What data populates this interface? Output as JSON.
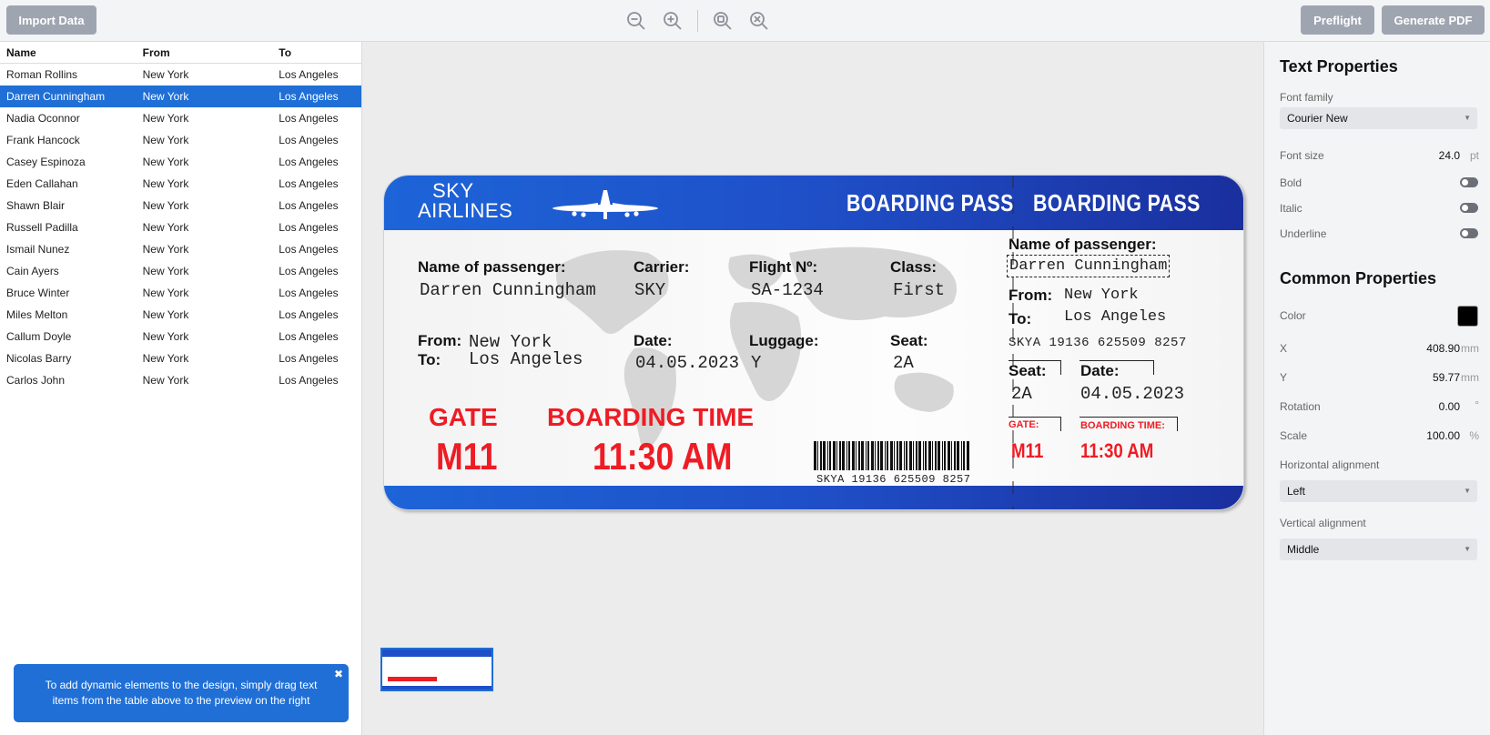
{
  "toolbar": {
    "import_label": "Import Data",
    "preflight_label": "Preflight",
    "generate_label": "Generate PDF"
  },
  "table": {
    "headers": [
      "Name",
      "From",
      "To"
    ],
    "rows": [
      [
        "Roman Rollins",
        "New York",
        "Los Angeles"
      ],
      [
        "Darren Cunningham",
        "New York",
        "Los Angeles"
      ],
      [
        "Nadia Oconnor",
        "New York",
        "Los Angeles"
      ],
      [
        "Frank Hancock",
        "New York",
        "Los Angeles"
      ],
      [
        "Casey Espinoza",
        "New York",
        "Los Angeles"
      ],
      [
        "Eden Callahan",
        "New York",
        "Los Angeles"
      ],
      [
        "Shawn Blair",
        "New York",
        "Los Angeles"
      ],
      [
        "Russell Padilla",
        "New York",
        "Los Angeles"
      ],
      [
        "Ismail Nunez",
        "New York",
        "Los Angeles"
      ],
      [
        "Cain Ayers",
        "New York",
        "Los Angeles"
      ],
      [
        "Bruce Winter",
        "New York",
        "Los Angeles"
      ],
      [
        "Miles Melton",
        "New York",
        "Los Angeles"
      ],
      [
        "Callum Doyle",
        "New York",
        "Los Angeles"
      ],
      [
        "Nicolas Barry",
        "New York",
        "Los Angeles"
      ],
      [
        "Carlos John",
        "New York",
        "Los Angeles"
      ]
    ]
  },
  "tip": {
    "text": "To add dynamic elements to the design, simply drag text items from the table above to the preview on the right",
    "close": "✖"
  },
  "ticket": {
    "brand_line1": "SKY",
    "brand_line2": "AIRLINES",
    "boarding_pass": "BOARDING PASS",
    "name_label": "Name of passenger:",
    "name_value": "Darren Cunningham",
    "carrier_label": "Carrier:",
    "carrier_value": "SKY",
    "flight_label": "Flight Nº:",
    "flight_value": "SA-1234",
    "class_label": "Class:",
    "class_value": "First",
    "from_label": "From:",
    "to_label": "To:",
    "from_value": "New York",
    "to_value": "Los Angeles",
    "date_label": "Date:",
    "date_value": "04.05.2023",
    "luggage_label": "Luggage:",
    "luggage_value": "Y",
    "seat_label": "Seat:",
    "seat_value": "2A",
    "gate_label": "GATE",
    "gate_value": "M11",
    "boarding_time_label": "BOARDING TIME",
    "boarding_time_value": "11:30 AM",
    "gate_label_stub": "GATE:",
    "boarding_time_label_stub": "BOARDING TIME:",
    "barcode_text": "SKYA 19136 625509 8257"
  },
  "properties": {
    "text_title": "Text Properties",
    "font_family_label": "Font family",
    "font_family_value": "Courier New",
    "font_size_label": "Font size",
    "font_size_value": "24.0",
    "font_size_unit": "pt",
    "bold_label": "Bold",
    "italic_label": "Italic",
    "underline_label": "Underline",
    "common_title": "Common Properties",
    "color_label": "Color",
    "color_value": "#000000",
    "x_label": "X",
    "x_value": "408.90",
    "y_label": "Y",
    "y_value": "59.77",
    "mm": "mm",
    "rotation_label": "Rotation",
    "rotation_value": "0.00",
    "rotation_unit": "°",
    "scale_label": "Scale",
    "scale_value": "100.00",
    "scale_unit": "%",
    "halign_label": "Horizontal alignment",
    "halign_value": "Left",
    "valign_label": "Vertical alignment",
    "valign_value": "Middle"
  },
  "colors": {
    "accent": "#1f6fd6",
    "ticket_blue": "#1f4fc8",
    "red": "#ee1c24"
  },
  "icons": [
    "zoom-out-icon",
    "zoom-in-icon",
    "zoom-fit-icon",
    "zoom-reset-icon",
    "airplane-icon",
    "world-map-icon",
    "barcode-icon",
    "chevron-down-icon"
  ]
}
